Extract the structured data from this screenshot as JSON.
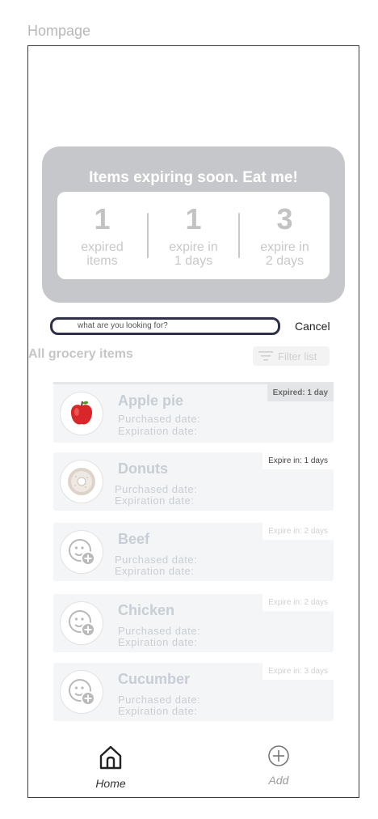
{
  "page_label": "Hompage",
  "banner": {
    "title": "Items expiring soon. Eat me!",
    "stats": [
      {
        "value": "1",
        "label": "expired\nitems"
      },
      {
        "value": "1",
        "label": "expire in\n1 days"
      },
      {
        "value": "3",
        "label": "expire in\n2 days"
      }
    ]
  },
  "search": {
    "placeholder": "what are you looking for?",
    "cancel_label": "Cancel"
  },
  "section": {
    "title": "All grocery items",
    "filter_label": "Filter list"
  },
  "items": [
    {
      "name": "Apple pie",
      "purchased": "Purchased date:",
      "expiration": "Expiration date:",
      "badge": "Expired: 1 day",
      "icon": "apple-icon"
    },
    {
      "name": "Donuts",
      "purchased": "Purchased date:",
      "expiration": "Expiration date:",
      "badge": "Expire in: 1 days",
      "icon": "donut-icon"
    },
    {
      "name": "Beef",
      "purchased": "Purchased date:",
      "expiration": "Expiration date:",
      "badge": "Expire in: 2 days",
      "icon": "add-photo-icon"
    },
    {
      "name": "Chicken",
      "purchased": "Purchased date:",
      "expiration": "Expiration date:",
      "badge": "Expire in: 2 days",
      "icon": "add-photo-icon"
    },
    {
      "name": "Cucumber",
      "purchased": "Purchased date:",
      "expiration": "Expiration date:",
      "badge": "Expire in: 3 days",
      "icon": "add-photo-icon"
    }
  ],
  "nav": {
    "home_label": "Home",
    "add_label": "Add"
  },
  "colors": {
    "banner_bg": "#c6c7ca",
    "card_bg": "#f4f5f7",
    "search_border": "#2e3047",
    "expired_badge_bg": "#e4e5e8"
  }
}
